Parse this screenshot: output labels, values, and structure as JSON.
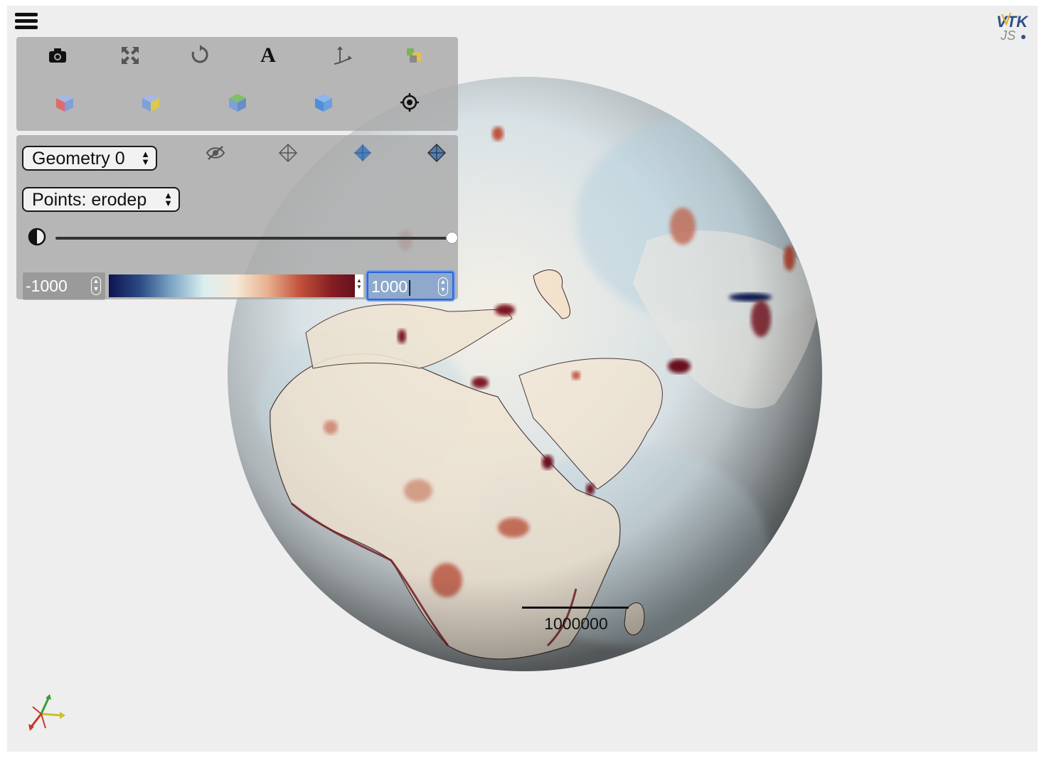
{
  "viewer": {
    "logo": {
      "line1": "VTK",
      "line2": "JS"
    }
  },
  "toolbar": {
    "row1": [
      {
        "icon": "camera-icon",
        "title": "screenshot"
      },
      {
        "icon": "expand-icon",
        "title": "reset camera"
      },
      {
        "icon": "rotate-icon",
        "title": "rotate"
      },
      {
        "icon": "text-icon",
        "glyph": "A"
      },
      {
        "icon": "axes-icon",
        "title": "orientation"
      },
      {
        "icon": "colors-icon",
        "title": "background"
      }
    ],
    "row2": [
      {
        "icon": "cube-red-icon",
        "color": "#e06a6a"
      },
      {
        "icon": "cube-yellow-icon",
        "color": "#e0c84a"
      },
      {
        "icon": "cube-green-icon",
        "color": "#7fbf6a"
      },
      {
        "icon": "cube-blue-icon",
        "color": "#4f8fd8"
      },
      {
        "icon": "target-icon"
      }
    ]
  },
  "panel": {
    "geometry_select": "Geometry 0",
    "field_select": "Points: erodep",
    "opacity_value": 1.0,
    "range_min": "-1000",
    "range_max": "1000",
    "colormap": [
      "#0d1450",
      "#2c4c86",
      "#7fa8c6",
      "#dceff1",
      "#f5e9d8",
      "#e8b08e",
      "#c2523b",
      "#861d24",
      "#5a0c1a"
    ]
  },
  "scene": {
    "scale_label": "1000000"
  }
}
